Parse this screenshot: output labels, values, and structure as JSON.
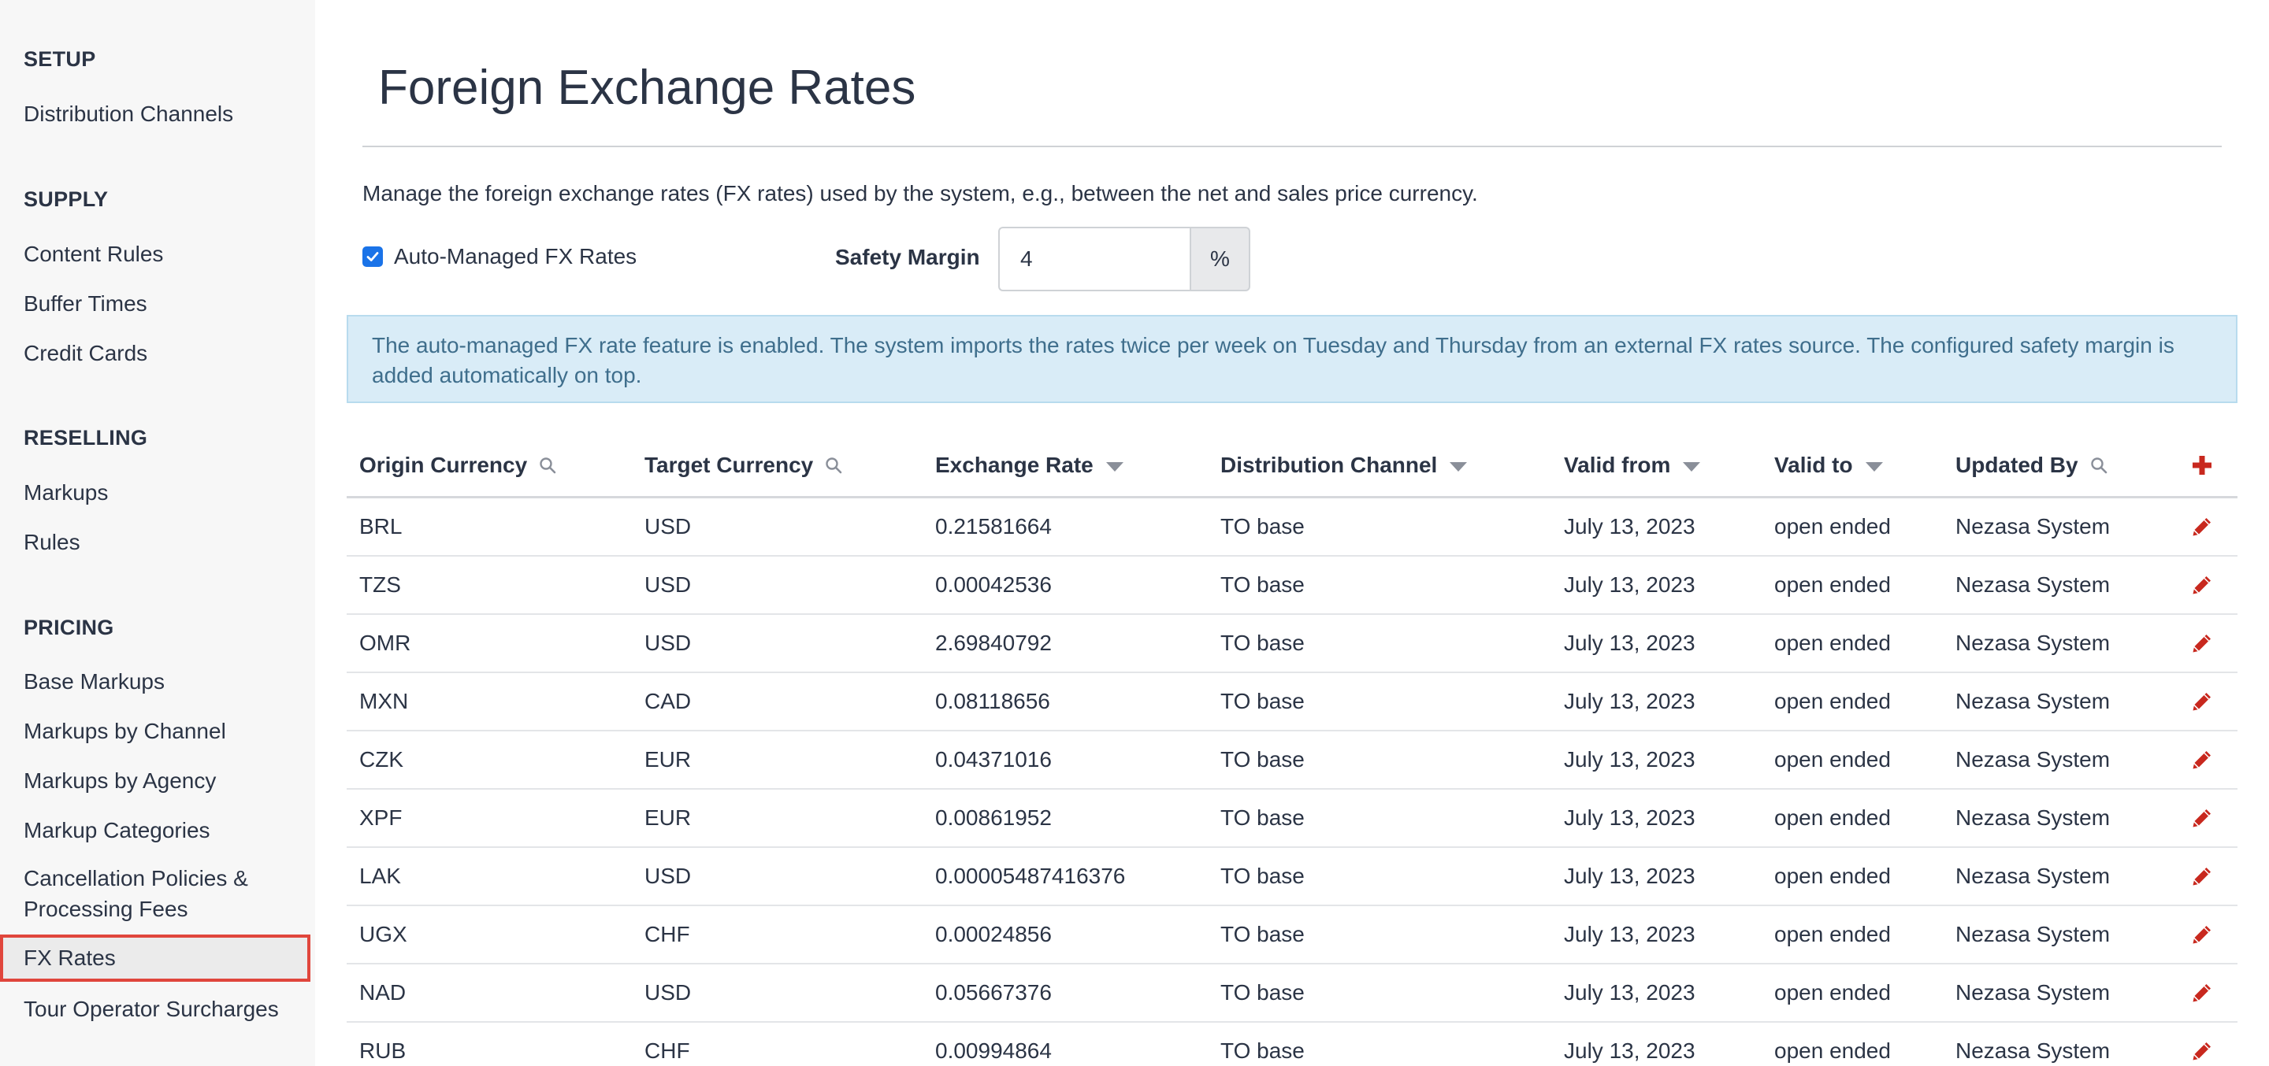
{
  "sidebar": {
    "sections": [
      {
        "heading": "SETUP",
        "items": [
          "Distribution Channels"
        ]
      },
      {
        "heading": "SUPPLY",
        "items": [
          "Content Rules",
          "Buffer Times",
          "Credit Cards"
        ]
      },
      {
        "heading": "RESELLING",
        "items": [
          "Markups",
          "Rules"
        ]
      },
      {
        "heading": "PRICING",
        "items": [
          "Base Markups",
          "Markups by Channel",
          "Markups by Agency",
          "Markup Categories",
          "Cancellation Policies & Processing Fees",
          "FX Rates",
          "Tour Operator Surcharges"
        ]
      }
    ],
    "active_item": "FX Rates"
  },
  "main": {
    "title": "Foreign Exchange Rates",
    "description": "Manage the foreign exchange rates (FX rates) used by the system, e.g., between the net and sales price currency.",
    "auto_managed": {
      "label": "Auto-Managed FX Rates",
      "checked": true
    },
    "safety_margin": {
      "label": "Safety Margin",
      "value": "4",
      "unit": "%"
    },
    "info": "The auto-managed FX rate feature is enabled. The system imports the rates twice per week on Tuesday and Thursday from an external FX rates source. The configured safety margin is added automatically on top."
  },
  "table": {
    "columns": [
      "Origin Currency",
      "Target Currency",
      "Exchange Rate",
      "Distribution Channel",
      "Valid from",
      "Valid to",
      "Updated By"
    ],
    "rows": [
      [
        "BRL",
        "USD",
        "0.21581664",
        "TO base",
        "July 13, 2023",
        "open ended",
        "Nezasa System"
      ],
      [
        "TZS",
        "USD",
        "0.00042536",
        "TO base",
        "July 13, 2023",
        "open ended",
        "Nezasa System"
      ],
      [
        "OMR",
        "USD",
        "2.69840792",
        "TO base",
        "July 13, 2023",
        "open ended",
        "Nezasa System"
      ],
      [
        "MXN",
        "CAD",
        "0.08118656",
        "TO base",
        "July 13, 2023",
        "open ended",
        "Nezasa System"
      ],
      [
        "CZK",
        "EUR",
        "0.04371016",
        "TO base",
        "July 13, 2023",
        "open ended",
        "Nezasa System"
      ],
      [
        "XPF",
        "EUR",
        "0.00861952",
        "TO base",
        "July 13, 2023",
        "open ended",
        "Nezasa System"
      ],
      [
        "LAK",
        "USD",
        "0.00005487416376",
        "TO base",
        "July 13, 2023",
        "open ended",
        "Nezasa System"
      ],
      [
        "UGX",
        "CHF",
        "0.00024856",
        "TO base",
        "July 13, 2023",
        "open ended",
        "Nezasa System"
      ],
      [
        "NAD",
        "USD",
        "0.05667376",
        "TO base",
        "July 13, 2023",
        "open ended",
        "Nezasa System"
      ],
      [
        "RUB",
        "CHF",
        "0.00994864",
        "TO base",
        "July 13, 2023",
        "open ended",
        "Nezasa System"
      ]
    ]
  },
  "icons": {
    "search": "search-icon",
    "sort": "sort-down-icon",
    "add": "plus-icon",
    "edit": "pencil-icon"
  },
  "colors": {
    "accent": "#c8281e",
    "active_border": "#e0463c",
    "info_bg": "#d9ecf7",
    "checkbox": "#1a73e8"
  }
}
